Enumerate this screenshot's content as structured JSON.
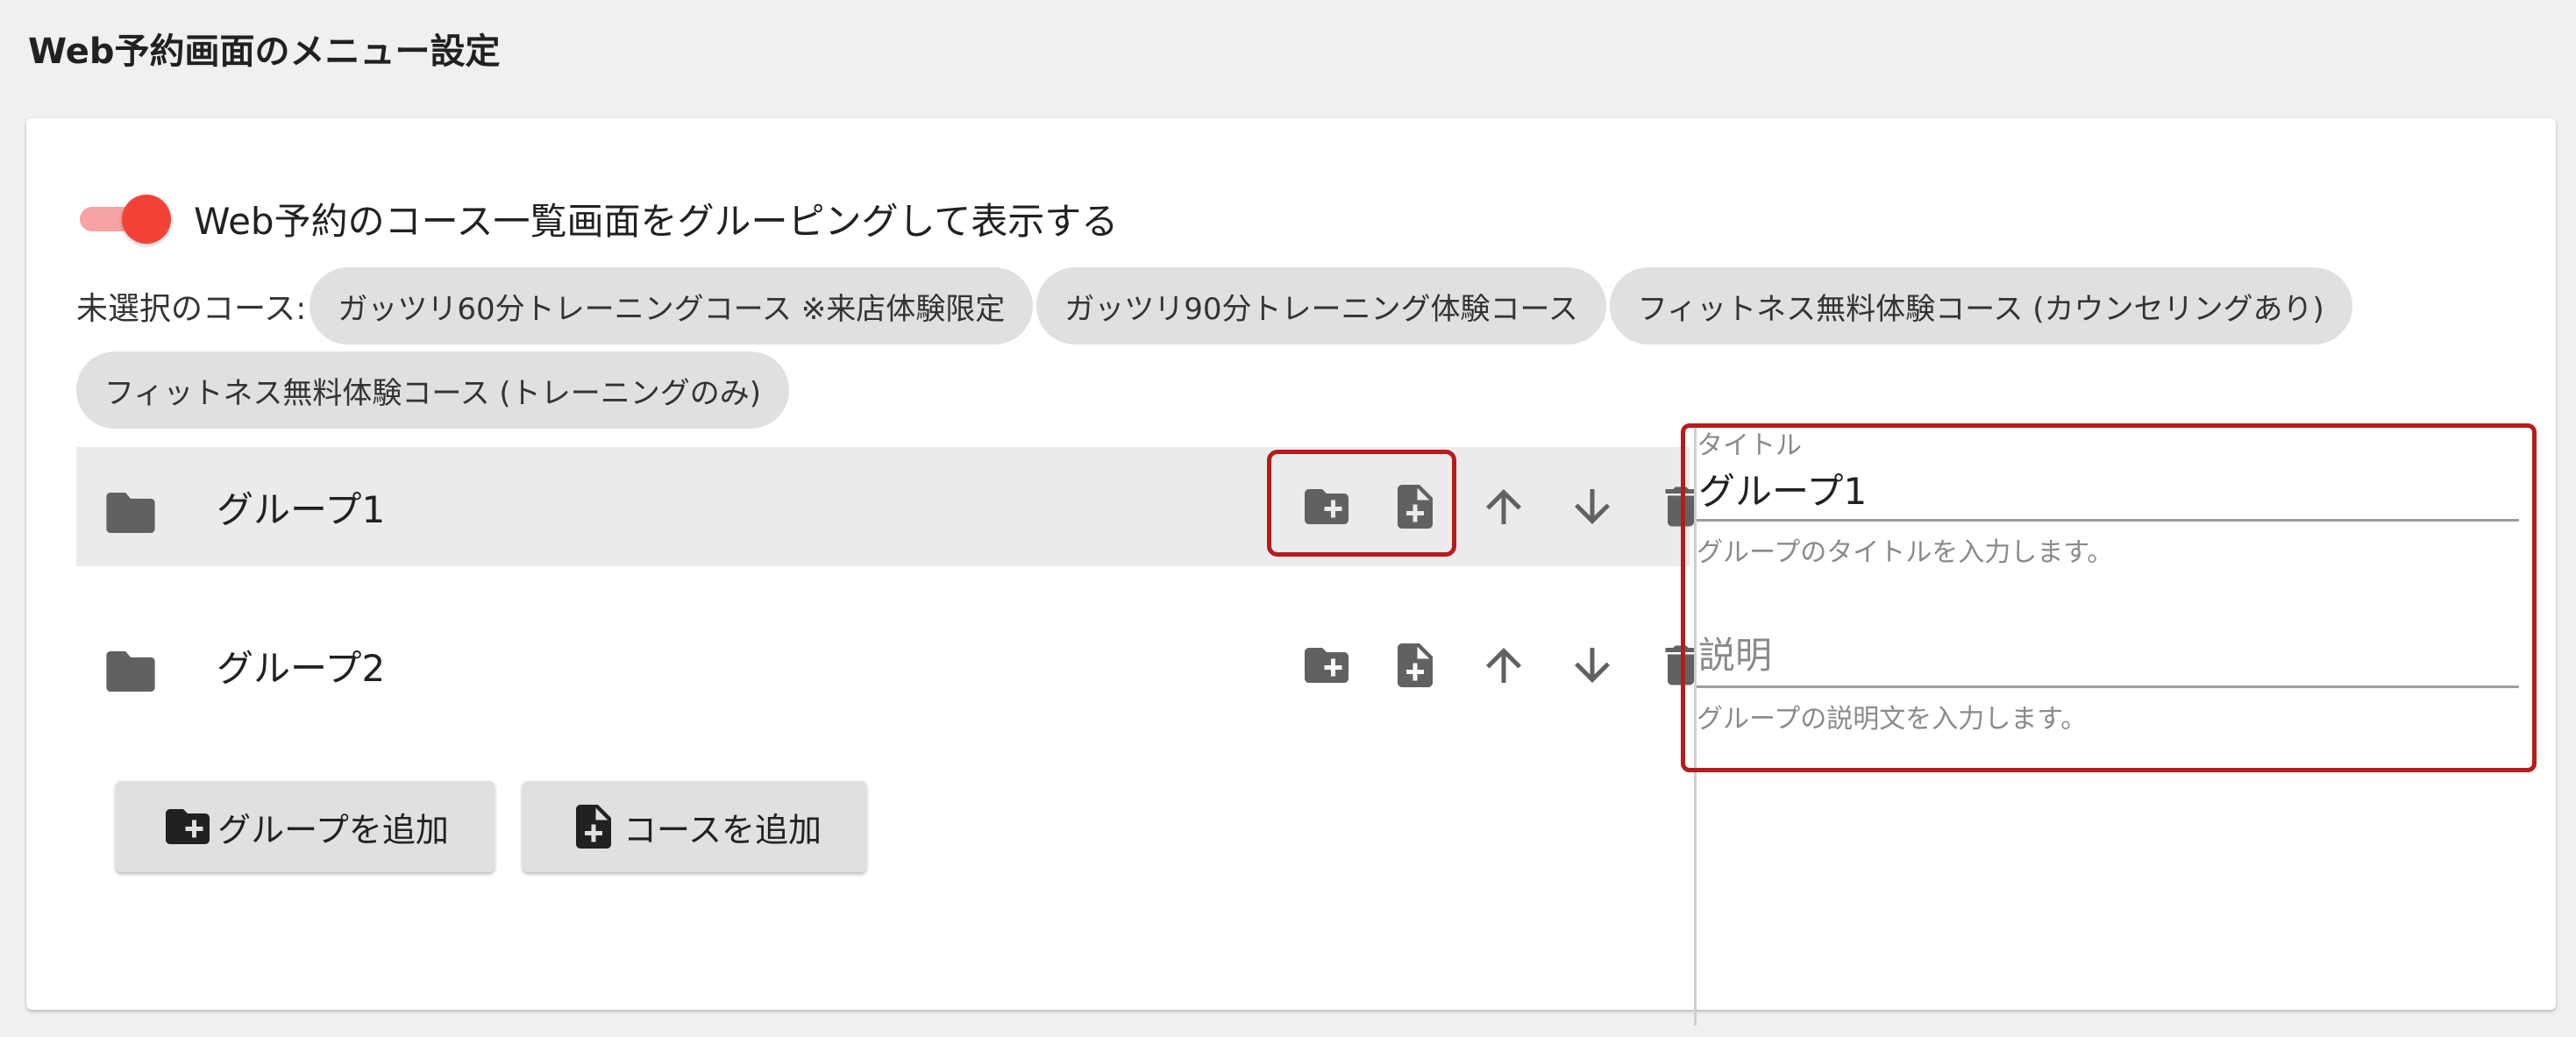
{
  "page": {
    "title": "Web予約画面のメニュー設定"
  },
  "grouping": {
    "enabled": true,
    "label": "Web予約のコース一覧画面をグルーピングして表示する"
  },
  "unselected_courses": {
    "label": "未選択のコース:",
    "chips": [
      "ガッツリ60分トレーニングコース ※来店体験限定",
      "ガッツリ90分トレーニング体験コース",
      "フィットネス無料体験コース (カウンセリングあり)",
      "フィットネス無料体験コース (トレーニングのみ)"
    ]
  },
  "groups": [
    {
      "name": "グループ1",
      "selected": true
    },
    {
      "name": "グループ2",
      "selected": false
    }
  ],
  "row_actions": [
    "folder-add-icon",
    "file-add-icon",
    "arrow-up-icon",
    "arrow-down-icon",
    "trash-icon"
  ],
  "buttons": {
    "add_group": "グループを追加",
    "add_course": "コースを追加"
  },
  "editor": {
    "title_label": "タイトル",
    "title_value": "グループ1",
    "title_hint": "グループのタイトルを入力します。",
    "description_placeholder": "説明",
    "description_value": "",
    "description_hint": "グループの説明文を入力します。"
  },
  "colors": {
    "accent": "#f44336",
    "highlight": "#b71c1c",
    "chip": "#e0e0e0",
    "icon": "#616161"
  }
}
